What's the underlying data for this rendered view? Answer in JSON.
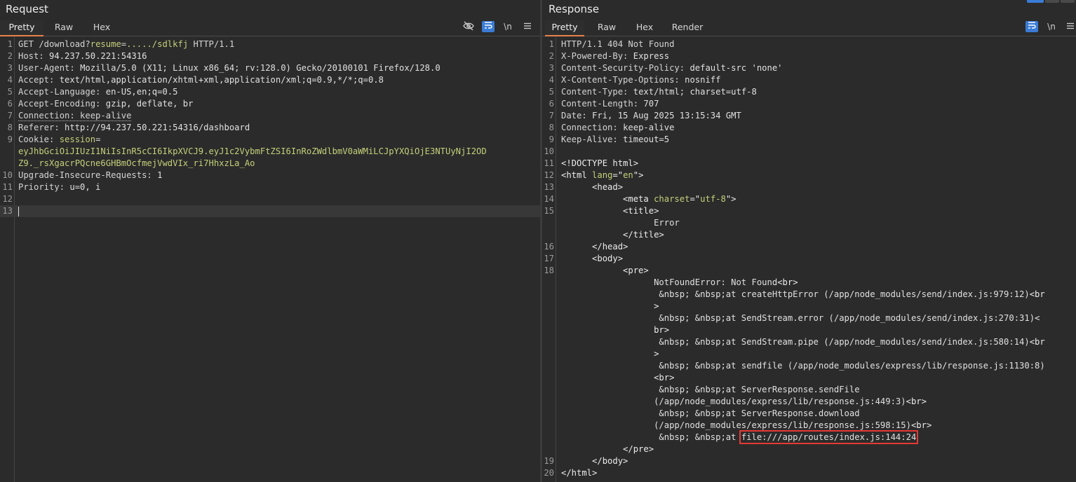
{
  "request": {
    "title": "Request",
    "tabs": [
      "Pretty",
      "Raw",
      "Hex"
    ],
    "toolbar": {
      "hide_icon": "eye-off-icon",
      "wrap_icon": "wrap-icon",
      "newline_label": "\\n",
      "menu_icon": "menu-icon"
    },
    "lines": [
      {
        "n": "1",
        "segments": [
          {
            "t": "GET /download?",
            "c": "h"
          },
          {
            "t": "resume",
            "c": "str"
          },
          {
            "t": "=",
            "c": "h"
          },
          {
            "t": "...../sdlkfj",
            "c": "str"
          },
          {
            "t": " HTTP/1.1",
            "c": "h"
          }
        ]
      },
      {
        "n": "2",
        "segments": [
          {
            "t": "Host: ",
            "c": "h"
          },
          {
            "t": "94.237.50.221:54316",
            "c": "v"
          }
        ]
      },
      {
        "n": "3",
        "segments": [
          {
            "t": "User-Agent: ",
            "c": "h"
          },
          {
            "t": "Mozilla/5.0 (X11; Linux x86_64; rv:128.0) Gecko/20100101 Firefox/128.0",
            "c": "v"
          }
        ]
      },
      {
        "n": "4",
        "segments": [
          {
            "t": "Accept: ",
            "c": "h"
          },
          {
            "t": "text/html,application/xhtml+xml,application/xml;q=0.9,*/*;q=0.8",
            "c": "v"
          }
        ]
      },
      {
        "n": "5",
        "segments": [
          {
            "t": "Accept-Language: ",
            "c": "h"
          },
          {
            "t": "en-US,en;q=0.5",
            "c": "v"
          }
        ]
      },
      {
        "n": "6",
        "segments": [
          {
            "t": "Accept-Encoding: ",
            "c": "h"
          },
          {
            "t": "gzip, deflate, br",
            "c": "v"
          }
        ]
      },
      {
        "n": "7",
        "segments": [
          {
            "t": "Connection: keep-alive",
            "c": "h dotted"
          }
        ]
      },
      {
        "n": "8",
        "segments": [
          {
            "t": "Referer: ",
            "c": "h"
          },
          {
            "t": "http://94.237.50.221:54316/dashboard",
            "c": "v"
          }
        ]
      },
      {
        "n": "9",
        "segments": [
          {
            "t": "Cookie: ",
            "c": "h"
          },
          {
            "t": "session",
            "c": "str"
          },
          {
            "t": "=",
            "c": "h"
          }
        ]
      },
      {
        "n": "",
        "segments": [
          {
            "t": "eyJhbGciOiJIUzI1NiIsInR5cCI6IkpXVCJ9.eyJ1c2VybmFtZSI6InRoZWdlbmV0aWMiLCJpYXQiOjE3NTUyNjI2OD",
            "c": "str"
          }
        ]
      },
      {
        "n": "",
        "segments": [
          {
            "t": "Z9._rsXgacrPQcne6GHBmOcfmejVwdVIx_ri7HhxzLa_Ao",
            "c": "str"
          }
        ]
      },
      {
        "n": "10",
        "segments": [
          {
            "t": "Upgrade-Insecure-Requests: ",
            "c": "h"
          },
          {
            "t": "1",
            "c": "v"
          }
        ]
      },
      {
        "n": "11",
        "segments": [
          {
            "t": "Priority: ",
            "c": "h"
          },
          {
            "t": "u=0, i",
            "c": "v"
          }
        ]
      },
      {
        "n": "12",
        "segments": []
      },
      {
        "n": "13",
        "segments": [],
        "current": true
      }
    ]
  },
  "response": {
    "title": "Response",
    "tabs": [
      "Pretty",
      "Raw",
      "Hex",
      "Render"
    ],
    "toolbar": {
      "wrap_icon": "wrap-icon",
      "newline_label": "\\n",
      "menu_icon": "menu-icon"
    },
    "lines": [
      {
        "n": "1",
        "segments": [
          {
            "t": "HTTP/1.1 404 Not Found",
            "c": "h"
          }
        ]
      },
      {
        "n": "2",
        "segments": [
          {
            "t": "X-Powered-By: ",
            "c": "h"
          },
          {
            "t": "Express",
            "c": "v"
          }
        ]
      },
      {
        "n": "3",
        "segments": [
          {
            "t": "Content-Security-Policy: ",
            "c": "h"
          },
          {
            "t": "default-src 'none'",
            "c": "v"
          }
        ]
      },
      {
        "n": "4",
        "segments": [
          {
            "t": "X-Content-Type-Options: ",
            "c": "h"
          },
          {
            "t": "nosniff",
            "c": "v"
          }
        ]
      },
      {
        "n": "5",
        "segments": [
          {
            "t": "Content-Type: ",
            "c": "h"
          },
          {
            "t": "text/html; charset=utf-8",
            "c": "v"
          }
        ]
      },
      {
        "n": "6",
        "segments": [
          {
            "t": "Content-Length: ",
            "c": "h"
          },
          {
            "t": "707",
            "c": "v"
          }
        ]
      },
      {
        "n": "7",
        "segments": [
          {
            "t": "Date: ",
            "c": "h"
          },
          {
            "t": "Fri, 15 Aug 2025 13:15:34 GMT",
            "c": "v"
          }
        ]
      },
      {
        "n": "8",
        "segments": [
          {
            "t": "Connection: ",
            "c": "h"
          },
          {
            "t": "keep-alive",
            "c": "v"
          }
        ]
      },
      {
        "n": "9",
        "segments": [
          {
            "t": "Keep-Alive: ",
            "c": "h"
          },
          {
            "t": "timeout=5",
            "c": "v"
          }
        ]
      },
      {
        "n": "10",
        "segments": []
      },
      {
        "n": "11",
        "segments": [
          {
            "t": "<!DOCTYPE html>",
            "c": "tag"
          }
        ]
      },
      {
        "n": "12",
        "segments": [
          {
            "t": "<html ",
            "c": "tag"
          },
          {
            "t": "lang",
            "c": "attr"
          },
          {
            "t": "=\"",
            "c": "tag"
          },
          {
            "t": "en",
            "c": "attr"
          },
          {
            "t": "\">",
            "c": "tag"
          }
        ]
      },
      {
        "n": "13",
        "segments": [
          {
            "t": "      <head>",
            "c": "tag"
          }
        ]
      },
      {
        "n": "14",
        "segments": [
          {
            "t": "            <meta ",
            "c": "tag"
          },
          {
            "t": "charset",
            "c": "attr"
          },
          {
            "t": "=\"",
            "c": "tag"
          },
          {
            "t": "utf-8",
            "c": "attr"
          },
          {
            "t": "\">",
            "c": "tag"
          }
        ]
      },
      {
        "n": "15",
        "segments": [
          {
            "t": "            <title>",
            "c": "tag"
          }
        ]
      },
      {
        "n": "",
        "segments": [
          {
            "t": "                  Error",
            "c": "v"
          }
        ]
      },
      {
        "n": "",
        "segments": [
          {
            "t": "            </title>",
            "c": "tag"
          }
        ]
      },
      {
        "n": "16",
        "segments": [
          {
            "t": "      </head>",
            "c": "tag"
          }
        ]
      },
      {
        "n": "17",
        "segments": [
          {
            "t": "      <body>",
            "c": "tag"
          }
        ]
      },
      {
        "n": "18",
        "segments": [
          {
            "t": "            <pre>",
            "c": "tag"
          }
        ]
      },
      {
        "n": "",
        "segments": [
          {
            "t": "                  NotFoundError: Not Found",
            "c": "v"
          },
          {
            "t": "<br>",
            "c": "tag"
          }
        ]
      },
      {
        "n": "",
        "segments": [
          {
            "t": "                   &nbsp; &nbsp;at createHttpError (/app/node_modules/send/index.js:979:12)",
            "c": "v"
          },
          {
            "t": "<br",
            "c": "tag"
          }
        ]
      },
      {
        "n": "",
        "segments": [
          {
            "t": "                  >",
            "c": "tag"
          }
        ]
      },
      {
        "n": "",
        "segments": [
          {
            "t": "                   &nbsp; &nbsp;at SendStream.error (/app/node_modules/send/index.js:270:31)",
            "c": "v"
          },
          {
            "t": "<",
            "c": "tag"
          }
        ]
      },
      {
        "n": "",
        "segments": [
          {
            "t": "                  br>",
            "c": "tag"
          }
        ]
      },
      {
        "n": "",
        "segments": [
          {
            "t": "                   &nbsp; &nbsp;at SendStream.pipe (/app/node_modules/send/index.js:580:14)",
            "c": "v"
          },
          {
            "t": "<br",
            "c": "tag"
          }
        ]
      },
      {
        "n": "",
        "segments": [
          {
            "t": "                  >",
            "c": "tag"
          }
        ]
      },
      {
        "n": "",
        "segments": [
          {
            "t": "                   &nbsp; &nbsp;at sendfile (/app/node_modules/express/lib/response.js:1130:8)",
            "c": "v"
          }
        ]
      },
      {
        "n": "",
        "segments": [
          {
            "t": "                  <br>",
            "c": "tag"
          }
        ]
      },
      {
        "n": "",
        "segments": [
          {
            "t": "                   &nbsp; &nbsp;at ServerResponse.sendFile",
            "c": "v"
          }
        ]
      },
      {
        "n": "",
        "segments": [
          {
            "t": "                  (/app/node_modules/express/lib/response.js:449:3)",
            "c": "v"
          },
          {
            "t": "<br>",
            "c": "tag"
          }
        ]
      },
      {
        "n": "",
        "segments": [
          {
            "t": "                   &nbsp; &nbsp;at ServerResponse.download",
            "c": "v"
          }
        ]
      },
      {
        "n": "",
        "segments": [
          {
            "t": "                  (/app/node_modules/express/lib/response.js:598:15)",
            "c": "v"
          },
          {
            "t": "<br>",
            "c": "tag"
          }
        ]
      },
      {
        "n": "",
        "segments": [
          {
            "t": "                   &nbsp; &nbsp;at ",
            "c": "v"
          },
          {
            "t": "file:///app/routes/index.js:144:24",
            "c": "v highlight-box"
          }
        ]
      },
      {
        "n": "",
        "segments": [
          {
            "t": "            </pre>",
            "c": "tag"
          }
        ]
      },
      {
        "n": "19",
        "segments": [
          {
            "t": "      </body>",
            "c": "tag"
          }
        ]
      },
      {
        "n": "20",
        "segments": [
          {
            "t": "</html>",
            "c": "tag"
          }
        ]
      }
    ]
  },
  "colors": {
    "accent": "#e8824b",
    "wrap_button": "#3a7bd5",
    "highlight": "#e53935"
  }
}
